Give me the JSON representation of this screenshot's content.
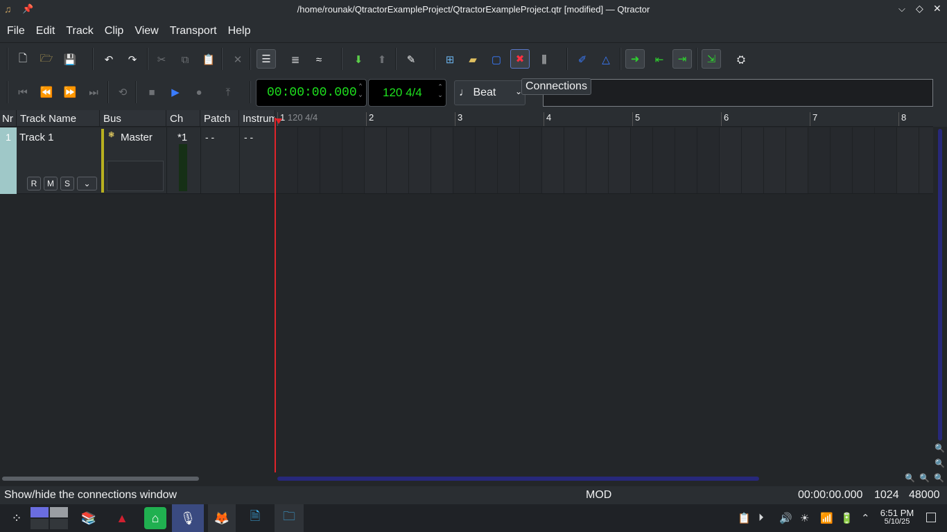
{
  "window": {
    "title": "/home/rounak/QtractorExampleProject/QtractorExampleProject.qtr [modified] — Qtractor"
  },
  "menu": [
    "File",
    "Edit",
    "Track",
    "Clip",
    "View",
    "Transport",
    "Help"
  ],
  "transport": {
    "time": "00:00:00.000",
    "tempo": "120 4/4",
    "snap": "Beat"
  },
  "tooltip": "Connections",
  "columns": [
    "Nr",
    "Track Name",
    "Bus",
    "Ch",
    "Patch",
    "Instrument"
  ],
  "track": {
    "number": "1",
    "name": "Track 1",
    "bus": "Master",
    "channel": "*1",
    "patch": "- -",
    "instrument": "- -",
    "buttons": [
      "R",
      "M",
      "S"
    ]
  },
  "ruler": {
    "first_label": "120 4/4",
    "bars": [
      "1",
      "2",
      "3",
      "4",
      "5",
      "6",
      "7",
      "8"
    ]
  },
  "status": {
    "message": "Show/hide the connections window",
    "mode": "MOD",
    "time": "00:00:00.000",
    "buffer": "1024",
    "rate": "48000"
  },
  "clock": {
    "time": "6:51 PM",
    "date": "5/10/25"
  },
  "colors": {
    "lcd_green": "#1ee21e",
    "playhead": "#e0242a",
    "accent": "#3daee9",
    "bus_bar": "#b8b020"
  }
}
